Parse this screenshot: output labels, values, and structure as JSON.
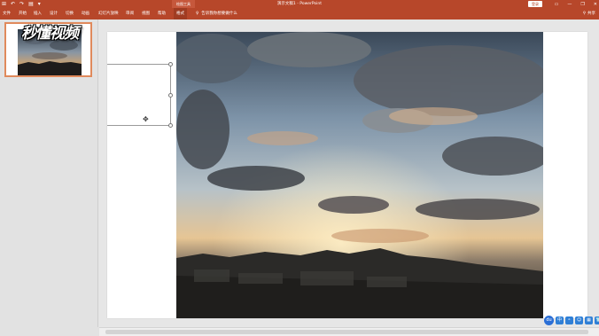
{
  "titlebar": {
    "quick_access": [
      "⊞",
      "↶",
      "↷",
      "▤",
      "▾"
    ],
    "context_group": "绘图工具",
    "document_title": "演示文稿1 - PowerPoint",
    "login": "登录",
    "window_controls": [
      "▭",
      "—",
      "❐",
      "✕"
    ]
  },
  "ribbon": {
    "tabs": [
      {
        "label": "文件"
      },
      {
        "label": "开始"
      },
      {
        "label": "插入"
      },
      {
        "label": "设计"
      },
      {
        "label": "切换"
      },
      {
        "label": "动画"
      },
      {
        "label": "幻灯片放映"
      },
      {
        "label": "审阅"
      },
      {
        "label": "视图"
      },
      {
        "label": "帮助"
      },
      {
        "label": "格式"
      }
    ],
    "tell_me": "告诉我你想要做什么",
    "share": "共享"
  },
  "thumbnails": {
    "slide_number": "1"
  },
  "watermark": "秒懂视频",
  "tray": [
    "du",
    "中",
    "⚬",
    "☺",
    "▦",
    "👕"
  ],
  "colors": {
    "accent": "#b7472a",
    "thumb_border": "#e08a5c"
  }
}
